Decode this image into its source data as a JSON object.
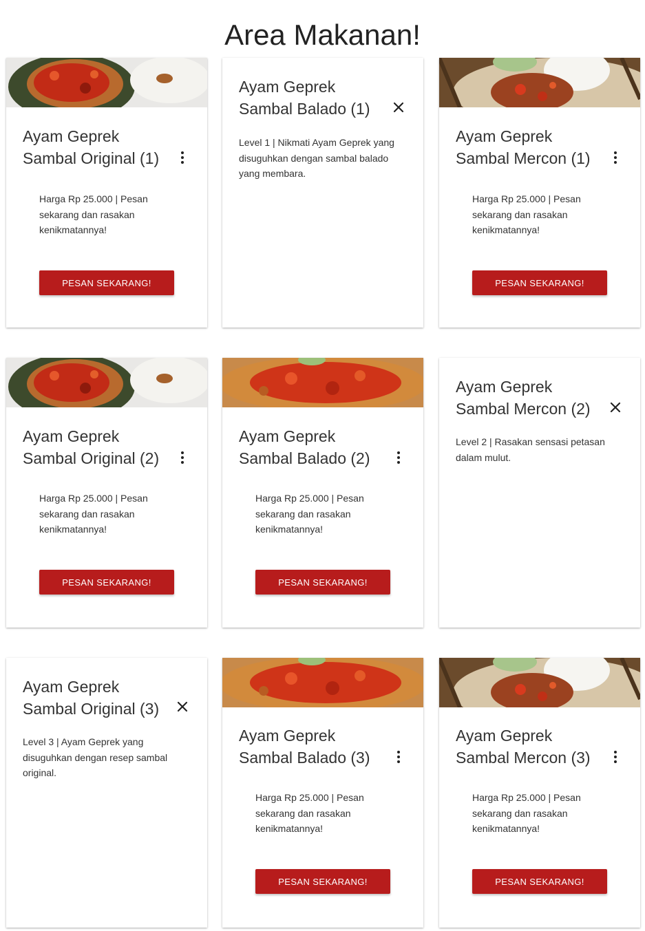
{
  "page": {
    "title": "Area Makanan!"
  },
  "colors": {
    "button": "#b71c1c",
    "button_text": "#ffffff",
    "card_bg": "#ffffff"
  },
  "cards": [
    {
      "title": "Ayam Geprek Sambal Original (1)",
      "text": "Harga Rp 25.000 | Pesan sekarang dan rasakan kenikmatannya!",
      "button": "PESAN SEKARANG!",
      "state": "front",
      "action_icon": "more-vert-icon"
    },
    {
      "title": "Ayam Geprek Sambal Balado (1)",
      "text": "Level 1 | Nikmati Ayam Geprek yang disuguhkan dengan sambal balado yang membara.",
      "state": "revealed",
      "action_icon": "close-icon"
    },
    {
      "title": "Ayam Geprek Sambal Mercon (1)",
      "text": "Harga Rp 25.000 | Pesan sekarang dan rasakan kenikmatannya!",
      "button": "PESAN SEKARANG!",
      "state": "front",
      "action_icon": "more-vert-icon"
    },
    {
      "title": "Ayam Geprek Sambal Original (2)",
      "text": "Harga Rp 25.000 | Pesan sekarang dan rasakan kenikmatannya!",
      "button": "PESAN SEKARANG!",
      "state": "front",
      "action_icon": "more-vert-icon"
    },
    {
      "title": "Ayam Geprek Sambal Balado (2)",
      "text": "Harga Rp 25.000 | Pesan sekarang dan rasakan kenikmatannya!",
      "button": "PESAN SEKARANG!",
      "state": "front",
      "action_icon": "more-vert-icon"
    },
    {
      "title": "Ayam Geprek Sambal Mercon (2)",
      "text": "Level 2 | Rasakan sensasi petasan dalam mulut.",
      "state": "revealed",
      "action_icon": "close-icon"
    },
    {
      "title": "Ayam Geprek Sambal Original (3)",
      "text": "Level 3 | Ayam Geprek yang disuguhkan dengan resep sambal original.",
      "state": "revealed",
      "action_icon": "close-icon"
    },
    {
      "title": "Ayam Geprek Sambal Balado (3)",
      "text": "Harga Rp 25.000 | Pesan sekarang dan rasakan kenikmatannya!",
      "button": "PESAN SEKARANG!",
      "state": "front",
      "action_icon": "more-vert-icon"
    },
    {
      "title": "Ayam Geprek Sambal Mercon (3)",
      "text": "Harga Rp 25.000 | Pesan sekarang dan rasakan kenikmatannya!",
      "button": "PESAN SEKARANG!",
      "state": "front",
      "action_icon": "more-vert-icon"
    }
  ]
}
